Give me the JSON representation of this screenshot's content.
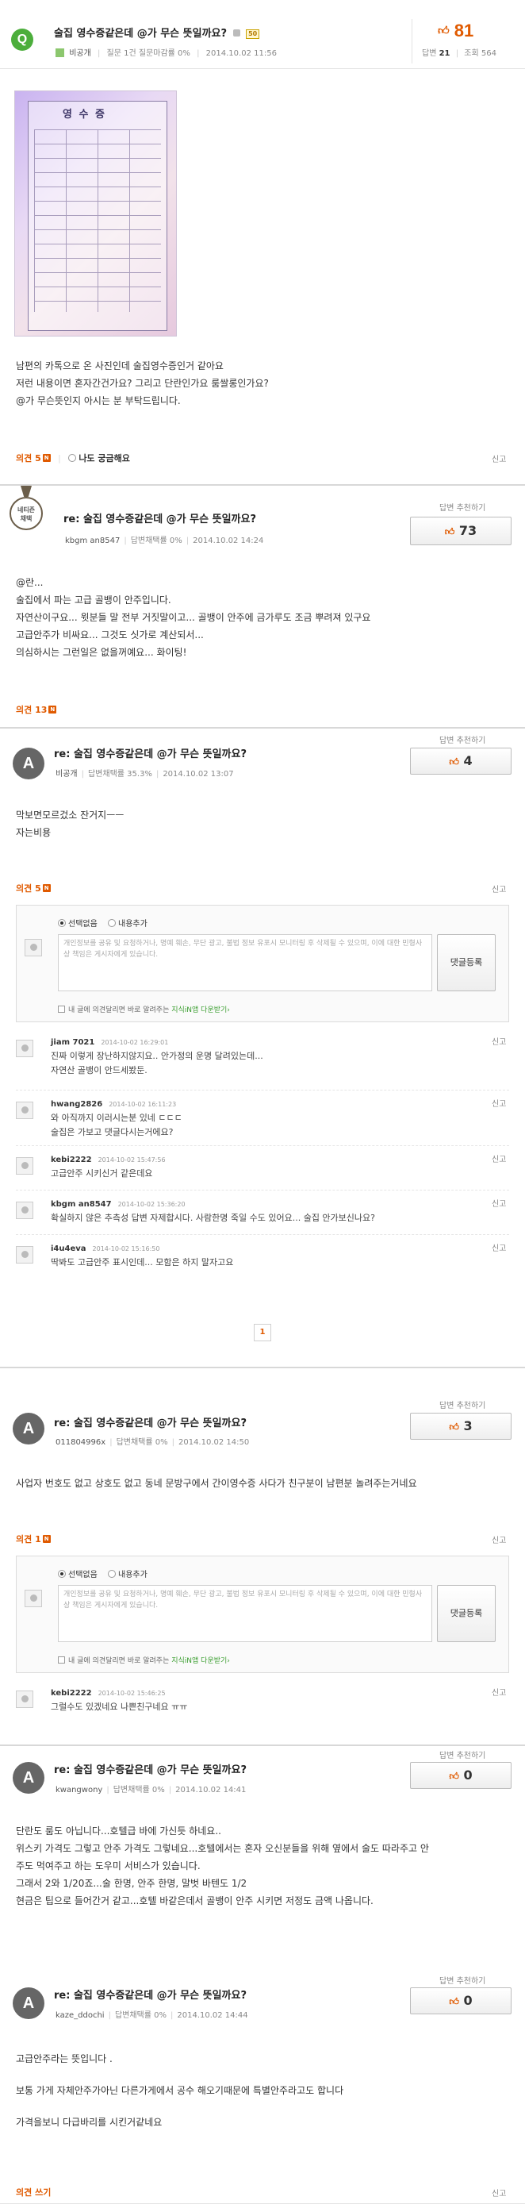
{
  "question": {
    "q_icon": "Q",
    "title": "술집 영수증같은데 @가 무슨 뜻일까요?",
    "tag": "50",
    "author": "비공개",
    "stats": "질문 1건 질문마감률 0%",
    "date": "2014.10.02 11:56",
    "likes": "81",
    "answers_label": "답변",
    "answers_count": "21",
    "views_label": "조회",
    "views_count": "564",
    "body": [
      "남편의 카톡으로 온 사진인데 술집영수증인거 같아요",
      "저런 내용이면 혼자간건가요? 그리고 단란인가요 룸쌀롱인가요?",
      "@가 무슨뜻인지 아시는 분 부탁드립니다."
    ],
    "opinion": "의견 5",
    "curious": "나도 궁금해요",
    "report": "신고"
  },
  "receipt": {
    "title": "영 수 증"
  },
  "answers": [
    {
      "title": "re: 술집 영수증같은데 @가 무슨 뜻일까요?",
      "author": "kbgm an8547",
      "rate": "답변채택률 0%",
      "date": "2014.10.02 14:24",
      "recommend_label": "답변 추천하기",
      "likes": "73",
      "avatar_line1": "네티즌",
      "avatar_line2": "채택",
      "body": [
        "@란...",
        "술집에서 파는 고급 골뱅이 안주입니다.",
        "자연산이구요... 윗분들 말 전부 거짓말이고... 골뱅이 안주에 금가루도 조금 뿌려져 있구요",
        "고급안주가 비싸요... 그것도 싯가로 계산되서...",
        "의심하시는 그런일은 없을꺼예요... 화이팅!"
      ],
      "opinion": "의견 13"
    },
    {
      "title": "re: 술집 영수증같은데 @가 무슨 뜻일까요?",
      "author": "비공개",
      "rate": "답변채택률 35.3%",
      "date": "2014.10.02 13:07",
      "recommend_label": "답변 추천하기",
      "likes": "4",
      "avatar": "A",
      "body": [
        "막보면모르겄소 잔거지ㅡㅡ",
        "자는비용"
      ],
      "opinion": "의견 5",
      "report": "신고"
    },
    {
      "title": "re: 술집 영수증같은데 @가 무슨 뜻일까요?",
      "author": "011804996x",
      "rate": "답변채택률 0%",
      "date": "2014.10.02 14:50",
      "recommend_label": "답변 추천하기",
      "likes": "3",
      "avatar": "A",
      "body": [
        "사업자 번호도 없고 상호도 없고 동네 문방구에서 간이영수증 사다가 친구분이 남편분 놀려주는거네요"
      ],
      "opinion": "의견 1",
      "report": "신고"
    },
    {
      "title": "re: 술집 영수증같은데 @가 무슨 뜻일까요?",
      "author": "kwangwony",
      "rate": "답변채택률 0%",
      "date": "2014.10.02 14:41",
      "recommend_label": "답변 추천하기",
      "likes": "0",
      "avatar": "A",
      "body": [
        "단란도 룸도 아닙니다...호텔급 바에 가신듯 하네요..",
        "위스키 가격도 그렇고 안주 가격도 그렇네요...호텔에서는 혼자 오신분들을 위해 옆에서 술도 따라주고 안",
        "주도 먹여주고 하는  도우미 서비스가 있습니다.",
        "그래서 2와 1/20죠...술 한명, 안주 한명, 말벗 바텐도 1/2",
        "현금은 팁으로 들어간거 같고...호텔 바같은데서 골뱅이 안주 시키면 저정도 금액 나옵니다."
      ]
    },
    {
      "title": "re: 술집 영수증같은데 @가 무슨 뜻일까요?",
      "author": "kaze_ddochi",
      "rate": "답변채택률 0%",
      "date": "2014.10.02 14:44",
      "recommend_label": "답변 추천하기",
      "likes": "0",
      "avatar": "A",
      "body": [
        "고급안주라는 뜻입니다 .",
        "보통 가게 자체안주가아닌 다른가게에서 공수 해오기때문에 특별안주라고도 합니다",
        "가격을보니 다급바리를 시킨거같네요"
      ],
      "opinion": "의견 쓰기",
      "report": "신고"
    }
  ],
  "comment_form": {
    "radio_none": "선택없음",
    "radio_add": "내용추가",
    "placeholder": "개인정보를 공유 및 요청하거나, 명예 훼손, 무단 광고, 불법 정보 유포시 모니터링 후 삭제될 수 있으며, 이에 대한 민형사상 책임은 게시자에게 있습니다.",
    "submit": "댓글등록",
    "notice_prefix": "내 글에 의견달리면 바로 알려주는 ",
    "notice_link": "지식iN앱 다운받기",
    "notice_suffix": "›"
  },
  "comments_a2": [
    {
      "name": "jiam 7021",
      "time": "2014-10-02 16:29:01",
      "lines": [
        "진짜 이렇게 장난하지않지요.. 안가정의 운명 달려있는데...",
        "자연산 골뱅이 안드세봤둔."
      ],
      "report": "신고"
    },
    {
      "name": "hwang2826",
      "time": "2014-10-02 16:11:23",
      "lines": [
        "와 아직까지 이러시는분 있네 ㄷㄷㄷ",
        "술집은 가보고 댓글다시는거에요?"
      ],
      "report": "신고"
    },
    {
      "name": "kebi2222",
      "time": "2014-10-02 15:47:56",
      "lines": [
        "고급안주 시키신거 같은데요"
      ],
      "report": "신고"
    },
    {
      "name": "kbgm an8547",
      "time": "2014-10-02 15:36:20",
      "lines": [
        "확실하지 않은 추측성 답변 자제합시다. 사람한명 죽일 수도 있어요... 술집 안가보신나요?"
      ],
      "report": "신고"
    },
    {
      "name": "i4u4eva",
      "time": "2014-10-02 15:16:50",
      "lines": [
        "딱봐도 고급안주 표시인데... 모함은 하지 말자고요"
      ],
      "report": "신고"
    }
  ],
  "pagination": {
    "current": "1"
  },
  "comments_a3": [
    {
      "name": "kebi2222",
      "time": "2014-10-02 15:46:25",
      "lines": [
        "그럴수도 있겠네요 나쁜친구네요 ㅠㅠ"
      ],
      "report": "신고"
    }
  ]
}
